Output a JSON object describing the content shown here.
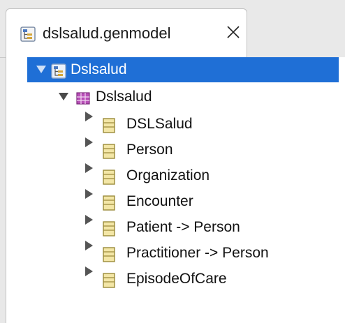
{
  "editor_tab": {
    "title": "dslsalud.genmodel",
    "icon": "genmodel-file-icon",
    "close_icon": "close-icon"
  },
  "tree": {
    "root": {
      "label": "Dslsalud",
      "icon": "genmodel-icon",
      "expanded": true,
      "selected": true
    },
    "package": {
      "label": "Dslsalud",
      "icon": "package-icon",
      "expanded": true
    },
    "classes": [
      {
        "label": "DSLSalud",
        "icon": "class-icon",
        "expanded": false
      },
      {
        "label": "Person",
        "icon": "class-icon",
        "expanded": false
      },
      {
        "label": "Organization",
        "icon": "class-icon",
        "expanded": false
      },
      {
        "label": "Encounter",
        "icon": "class-icon",
        "expanded": false
      },
      {
        "label": "Patient -> Person",
        "icon": "class-icon",
        "expanded": false
      },
      {
        "label": "Practitioner -> Person",
        "icon": "class-icon",
        "expanded": false
      },
      {
        "label": "EpisodeOfCare",
        "icon": "class-icon",
        "expanded": false
      }
    ]
  },
  "colors": {
    "selection": "#1f6fd6",
    "package": "#a832a8",
    "class_fill": "#f3e6a6",
    "class_stroke": "#9a8a3a"
  }
}
